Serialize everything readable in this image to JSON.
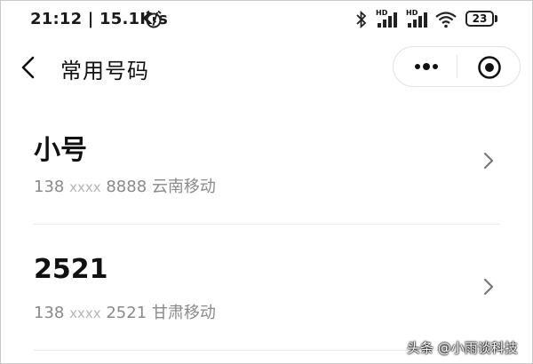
{
  "status_bar": {
    "time": "21:12",
    "net_speed": "15.1K/s",
    "alarm_icon": "alarm-clock-icon",
    "hd_label_1": "HD",
    "hd_label_2": "HD",
    "battery": "23"
  },
  "nav": {
    "title": "常用号码",
    "back_icon": "chevron-left-icon",
    "more_icon": "more-dots-icon",
    "close_icon": "target-close-icon"
  },
  "contacts": [
    {
      "name": "小号",
      "prefix": "138",
      "mask": "xxxx",
      "suffix": "8888",
      "carrier": "云南移动"
    },
    {
      "name": "2521",
      "prefix": "138",
      "mask": "xxxx",
      "suffix": "2521",
      "carrier": "甘肃移动"
    }
  ],
  "watermark": "头条 @小雨谈科技"
}
